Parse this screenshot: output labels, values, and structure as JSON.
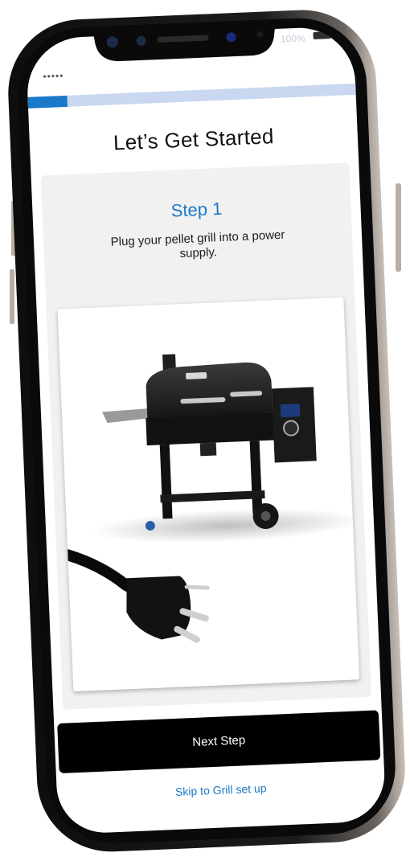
{
  "status_bar": {
    "signal": "•••••",
    "battery_label": "100%"
  },
  "progress": {
    "fraction": 0.12
  },
  "page": {
    "title": "Let’s Get Started"
  },
  "step": {
    "title": "Step 1",
    "description": "Plug your pellet grill into a power supply."
  },
  "actions": {
    "next_label": "Next Step",
    "skip_label": "Skip to Grill set up"
  },
  "colors": {
    "accent": "#1a79c8",
    "progress_track": "#c9d8f0",
    "button": "#000000",
    "card": "#f1f1f1"
  }
}
